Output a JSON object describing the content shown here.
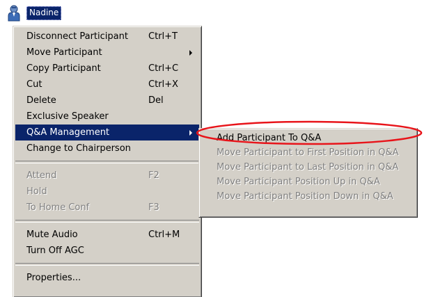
{
  "participant": {
    "name": "Nadine",
    "icon": "person-icon"
  },
  "context_menu": {
    "items": [
      {
        "label": "Disconnect Participant",
        "shortcut": "Ctrl+T"
      },
      {
        "label": "Move Participant",
        "submenu": true
      },
      {
        "label": "Copy Participant",
        "shortcut": "Ctrl+C"
      },
      {
        "label": "Cut",
        "shortcut": "Ctrl+X"
      },
      {
        "label": "Delete",
        "shortcut": "Del"
      },
      {
        "label": "Exclusive Speaker"
      },
      {
        "label": "Q&A Management",
        "submenu": true,
        "highlighted": true
      },
      {
        "label": "Change to Chairperson"
      },
      {
        "label": "Attend",
        "shortcut": "F2",
        "disabled": true
      },
      {
        "label": "Hold",
        "disabled": true
      },
      {
        "label": "To Home Conf",
        "shortcut": "F3",
        "disabled": true
      },
      {
        "label": "Mute Audio",
        "shortcut": "Ctrl+M"
      },
      {
        "label": "Turn Off AGC"
      },
      {
        "label": "Properties..."
      }
    ]
  },
  "qa_submenu": {
    "items": [
      {
        "label": "Add Participant To Q&A",
        "disabled": false
      },
      {
        "label": "Move Participant to First Position in Q&A",
        "disabled": true
      },
      {
        "label": "Move Participant to Last Position in Q&A",
        "disabled": true
      },
      {
        "label": "Move Participant Position Up in Q&A",
        "disabled": true
      },
      {
        "label": "Move Participant Position Down in Q&A",
        "disabled": true
      }
    ]
  },
  "colors": {
    "menu_background": "#d4d0c8",
    "highlight": "#0a246a",
    "annotation": "#e8141a",
    "disabled_text": "#808080"
  }
}
